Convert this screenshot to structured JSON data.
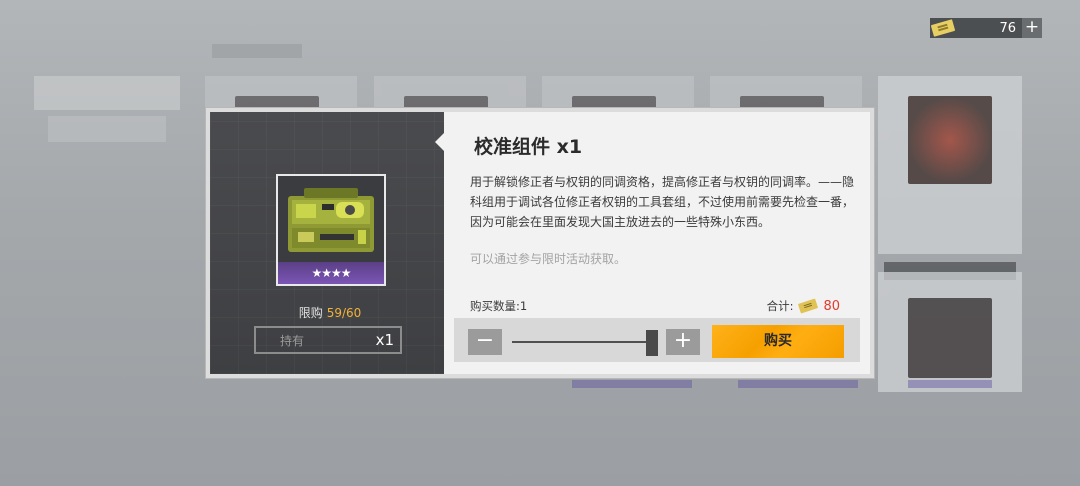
{
  "currency": {
    "amount": "76",
    "plus": "+",
    "icon": "ticket-icon",
    "color": "#e8cf63"
  },
  "dialog": {
    "item": {
      "name": "校准组件 x1",
      "rarity_stars": "★★★★",
      "icon": "toolbox-icon",
      "description": "用于解锁修正者与权钥的同调资格，提高修正者与权钥的同调率。——隐科组用于调试各位修正者权钥的工具套组，不过使用前需要先检查一番，因为可能会在里面发现大国主放进去的一些特殊小东西。",
      "obtain": "可以通过参与限时活动获取。"
    },
    "limit": {
      "label": "限购",
      "value": "59/60"
    },
    "owned": {
      "label": "持有",
      "value": "x1"
    },
    "purchase": {
      "quantity_label": "购买数量:1",
      "quantity": 1,
      "total_label": "合计:",
      "total_price": "80",
      "minus": "−",
      "plus": "+",
      "buy": "购买"
    }
  },
  "colors": {
    "accent": "#f6a000",
    "price": "#e03b2e",
    "limit": "#f2b13a",
    "rarity": "#7b55b5"
  }
}
